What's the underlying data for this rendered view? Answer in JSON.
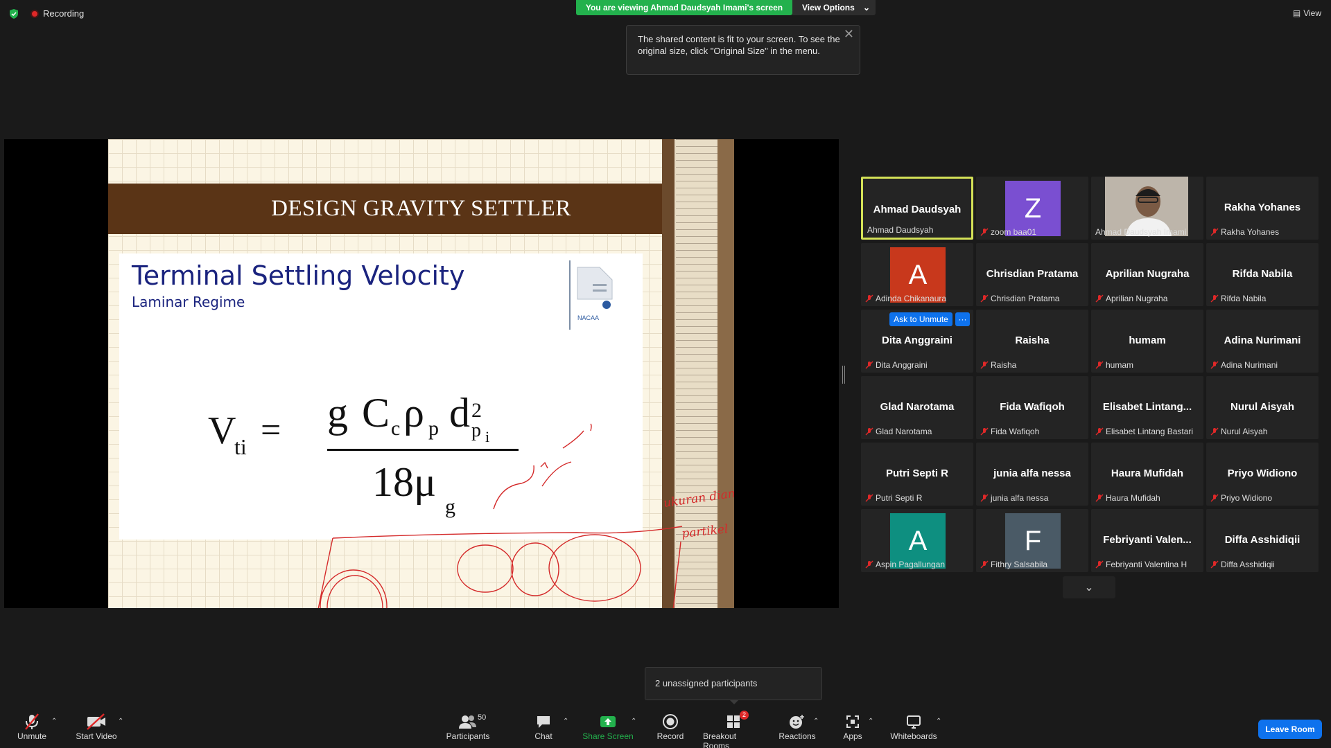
{
  "top": {
    "recording_label": "Recording",
    "viewing_banner": "You are viewing Ahmad Daudsyah Imami's screen",
    "view_options": "View Options",
    "view_label": "View",
    "tooltip_text": "The shared content is fit to your screen. To see the original size, click \"Original Size\" in the menu."
  },
  "slide": {
    "banner": "DESIGN GRAVITY SETTLER",
    "title": "Terminal Settling Velocity",
    "subtitle": "Laminar Regime",
    "logo_text": "NACAA",
    "annotation_1": "ukuran diameter",
    "annotation_2": "partikel"
  },
  "gallery": {
    "ask_to_unmute": "Ask to Unmute",
    "more": "···",
    "tiles": [
      {
        "name": "Ahmad Daudsyah",
        "label": "Ahmad Daudsyah"
      },
      {
        "initial": "Z",
        "label": "zoom baa01",
        "color": "#7a4fd1"
      },
      {
        "label": "Ahmad Daudsyah Imami"
      },
      {
        "name": "Rakha Yohanes",
        "label": "Rakha Yohanes"
      },
      {
        "initial": "A",
        "label": "Adinda Chikanaura",
        "color": "#c8381c"
      },
      {
        "name": "Chrisdian Pratama",
        "label": "Chrisdian Pratama"
      },
      {
        "name": "Aprilian Nugraha",
        "label": "Aprilian Nugraha"
      },
      {
        "name": "Rifda Nabila",
        "label": "Rifda Nabila"
      },
      {
        "name": "Dita Anggraini",
        "label": "Dita Anggraini"
      },
      {
        "name": "Raisha",
        "label": "Raisha"
      },
      {
        "name": "humam",
        "label": "humam"
      },
      {
        "name": "Adina Nurimani",
        "label": "Adina Nurimani"
      },
      {
        "name": "Glad Narotama",
        "label": "Glad Narotama"
      },
      {
        "name": "Fida Wafiqoh",
        "label": "Fida Wafiqoh"
      },
      {
        "name": "Elisabet  Lintang...",
        "label": "Elisabet Lintang Bastari"
      },
      {
        "name": "Nurul Aisyah",
        "label": "Nurul Aisyah"
      },
      {
        "name": "Putri Septi R",
        "label": "Putri Septi R"
      },
      {
        "name": "junia alfa nessa",
        "label": "junia alfa nessa"
      },
      {
        "name": "Haura Mufidah",
        "label": "Haura Mufidah"
      },
      {
        "name": "Priyo Widiono",
        "label": "Priyo Widiono"
      },
      {
        "initial": "A",
        "label": "Aspin Pagallungan",
        "color": "#0e8f80"
      },
      {
        "initial": "F",
        "label": "Fithry Salsabila",
        "color": "#4a5a66"
      },
      {
        "name": "Febriyanti  Valen...",
        "label": "Febriyanti Valentina H"
      },
      {
        "name": "Diffa Asshidiqii",
        "label": "Diffa Asshidiqii"
      }
    ]
  },
  "unassigned": "2 unassigned participants",
  "toolbar": {
    "unmute": "Unmute",
    "start_video": "Start Video",
    "participants": "Participants",
    "participants_count": "50",
    "chat": "Chat",
    "share_screen": "Share Screen",
    "record": "Record",
    "breakout_rooms": "Breakout Rooms",
    "breakout_badge": "2",
    "reactions": "Reactions",
    "apps": "Apps",
    "whiteboards": "Whiteboards",
    "leave_room": "Leave Room"
  },
  "colors": {
    "accent_green": "#23b14d",
    "accent_blue": "#0e72ed",
    "active_speaker": "#d4e157"
  }
}
